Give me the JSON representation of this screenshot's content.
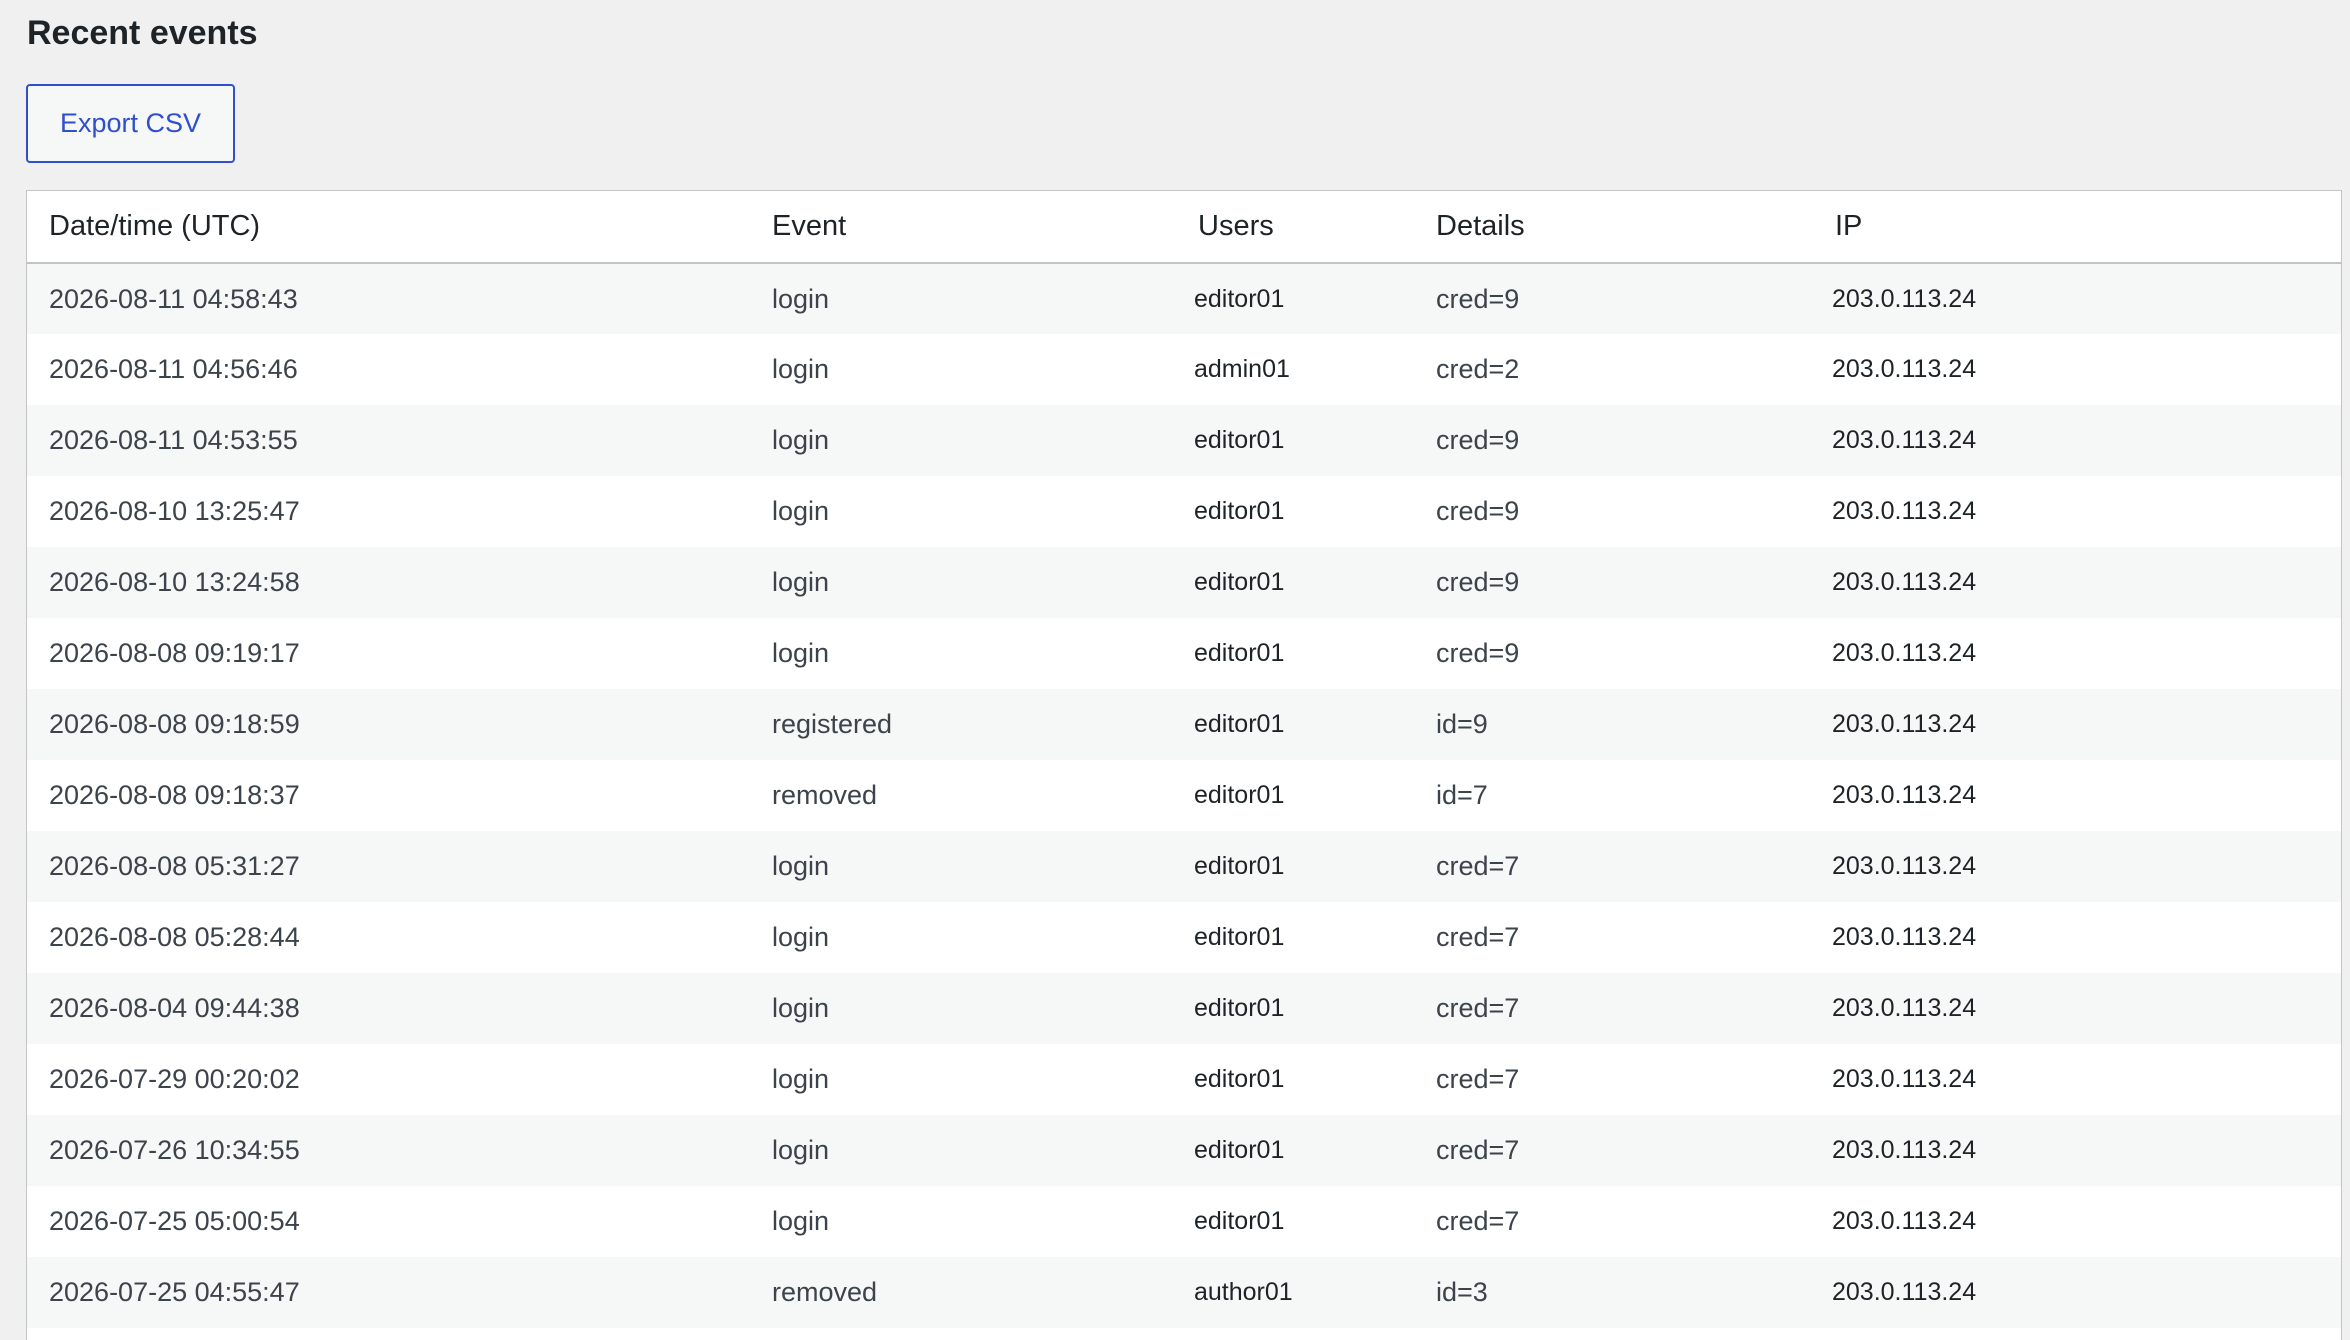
{
  "page": {
    "title": "Recent events"
  },
  "toolbar": {
    "export_label": "Export CSV"
  },
  "table": {
    "columns": {
      "datetime": "Date/time (UTC)",
      "event": "Event",
      "users": "Users",
      "details": "Details",
      "ip": "IP"
    },
    "rows": [
      {
        "datetime": "2026-08-11 04:58:43",
        "event": "login",
        "users": "editor01",
        "details": "cred=9",
        "ip": "203.0.113.24"
      },
      {
        "datetime": "2026-08-11 04:56:46",
        "event": "login",
        "users": "admin01",
        "details": "cred=2",
        "ip": "203.0.113.24"
      },
      {
        "datetime": "2026-08-11 04:53:55",
        "event": "login",
        "users": "editor01",
        "details": "cred=9",
        "ip": "203.0.113.24"
      },
      {
        "datetime": "2026-08-10 13:25:47",
        "event": "login",
        "users": "editor01",
        "details": "cred=9",
        "ip": "203.0.113.24"
      },
      {
        "datetime": "2026-08-10 13:24:58",
        "event": "login",
        "users": "editor01",
        "details": "cred=9",
        "ip": "203.0.113.24"
      },
      {
        "datetime": "2026-08-08 09:19:17",
        "event": "login",
        "users": "editor01",
        "details": "cred=9",
        "ip": "203.0.113.24"
      },
      {
        "datetime": "2026-08-08 09:18:59",
        "event": "registered",
        "users": "editor01",
        "details": "id=9",
        "ip": "203.0.113.24"
      },
      {
        "datetime": "2026-08-08 09:18:37",
        "event": "removed",
        "users": "editor01",
        "details": "id=7",
        "ip": "203.0.113.24"
      },
      {
        "datetime": "2026-08-08 05:31:27",
        "event": "login",
        "users": "editor01",
        "details": "cred=7",
        "ip": "203.0.113.24"
      },
      {
        "datetime": "2026-08-08 05:28:44",
        "event": "login",
        "users": "editor01",
        "details": "cred=7",
        "ip": "203.0.113.24"
      },
      {
        "datetime": "2026-08-04 09:44:38",
        "event": "login",
        "users": "editor01",
        "details": "cred=7",
        "ip": "203.0.113.24"
      },
      {
        "datetime": "2026-07-29 00:20:02",
        "event": "login",
        "users": "editor01",
        "details": "cred=7",
        "ip": "203.0.113.24"
      },
      {
        "datetime": "2026-07-26 10:34:55",
        "event": "login",
        "users": "editor01",
        "details": "cred=7",
        "ip": "203.0.113.24"
      },
      {
        "datetime": "2026-07-25 05:00:54",
        "event": "login",
        "users": "editor01",
        "details": "cred=7",
        "ip": "203.0.113.24"
      },
      {
        "datetime": "2026-07-25 04:55:47",
        "event": "removed",
        "users": "author01",
        "details": "id=3",
        "ip": "203.0.113.24"
      }
    ]
  }
}
